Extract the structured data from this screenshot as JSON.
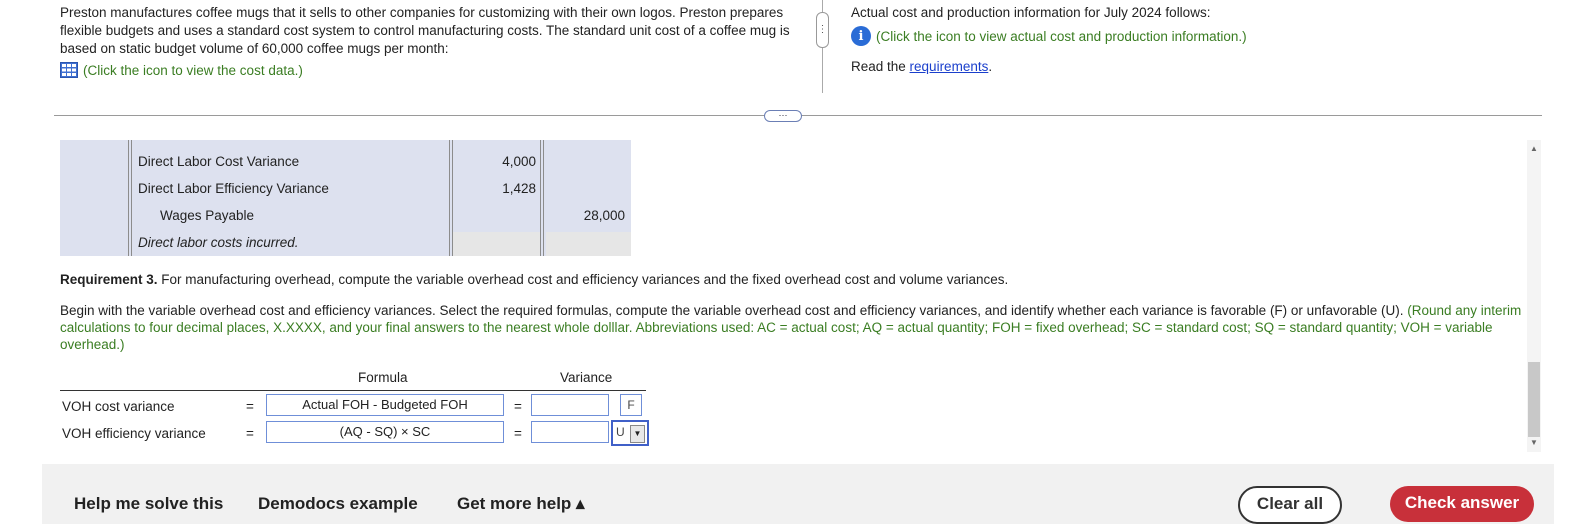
{
  "intro": {
    "text": "Preston manufactures coffee mugs that it sells to other companies for customizing with their own logos. Preston prepares flexible budgets and uses a standard cost system to control manufacturing costs. The standard unit cost of a coffee mug is based on static budget volume of 60,000 coffee mugs per month:",
    "cost_link": "(Click the icon to view the cost data.)",
    "grid_icon": "table-grid-icon"
  },
  "actual": {
    "text": "Actual cost and production information for July 2024 follows:",
    "info_link": "(Click the icon to view actual cost and production information.)",
    "info_glyph": "i",
    "read_prefix": "Read the ",
    "requirements_link": "requirements",
    "read_suffix": "."
  },
  "journal": {
    "rows": [
      {
        "account": "Direct Labor Cost Variance",
        "debit": "4,000",
        "credit": ""
      },
      {
        "account": "Direct Labor Efficiency Variance",
        "debit": "1,428",
        "credit": ""
      },
      {
        "account": "Wages Payable",
        "debit": "",
        "credit": "28,000"
      }
    ],
    "explanation": "Direct labor costs incurred."
  },
  "requirement3": {
    "label": "Requirement 3.",
    "text": " For manufacturing overhead, compute the variable overhead cost and efficiency variances and the fixed overhead cost and volume variances."
  },
  "instructions": {
    "text": "Begin with the variable overhead cost and efficiency variances. Select the required formulas, compute the variable overhead cost and efficiency variances, and identify whether each variance is favorable (F) or unfavorable (U). ",
    "green_text": "(Round any interim calculations to four decimal places, X.XXXX, and your final answers to the nearest whole dolllar. Abbreviations used: AC = actual cost; AQ = actual quantity; FOH = fixed overhead; SC = standard cost; SQ = standard quantity; VOH = variable overhead.)"
  },
  "formula_table": {
    "header_formula": "Formula",
    "header_variance": "Variance",
    "equals": "=",
    "rows": [
      {
        "label": "VOH cost variance",
        "formula": "Actual FOH - Budgeted FOH",
        "variance": "",
        "fu": "F"
      },
      {
        "label": "VOH efficiency variance",
        "formula": "(AQ - SQ) × SC",
        "variance": "",
        "fu": "U"
      }
    ],
    "dropdown_arrow": "▼"
  },
  "footer": {
    "help": "Help me solve this",
    "demodocs": "Demodocs example",
    "more_help": "Get more help ▴",
    "clear": "Clear all",
    "check": "Check answer"
  },
  "scroll": {
    "up": "▲",
    "down": "▼"
  },
  "handles": {
    "vertical": "⋮",
    "horizontal": "⋯"
  },
  "colors": {
    "link_green": "#3a7d22",
    "check_button": "#c8303a",
    "info_icon": "#2a6cd6"
  }
}
